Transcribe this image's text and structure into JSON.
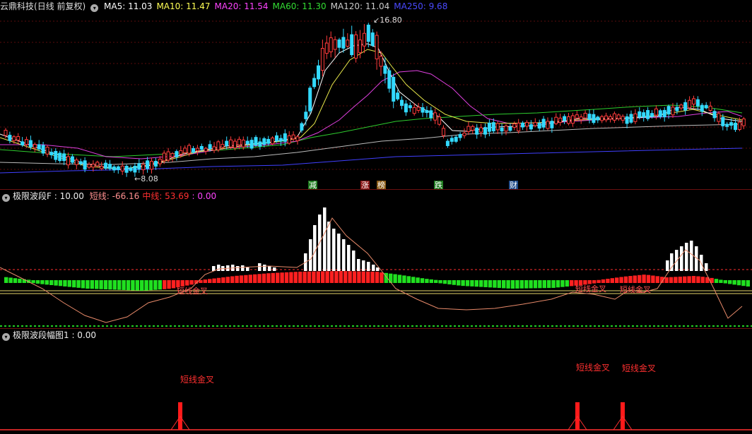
{
  "main_panel": {
    "stock_name": "云鼎科技",
    "period": "(日线 前复权)",
    "ma": [
      {
        "label": "MA5: 11.03",
        "color": "#ffffff"
      },
      {
        "label": "MA10: 11.47",
        "color": "#ffff55"
      },
      {
        "label": "MA20: 11.54",
        "color": "#ff44ff"
      },
      {
        "label": "MA60: 11.30",
        "color": "#33dd33"
      },
      {
        "label": "MA120: 11.04",
        "color": "#cccccc"
      },
      {
        "label": "MA250: 9.68",
        "color": "#4a4aff"
      }
    ],
    "high_label": "16.80",
    "low_label": "8.08",
    "events": [
      {
        "text": "减",
        "color": "#1e7a1e"
      },
      {
        "text": "涨",
        "color": "#8a1414"
      },
      {
        "text": "榜",
        "color": "#8a5a14"
      },
      {
        "text": "跌",
        "color": "#1e7a1e"
      },
      {
        "text": "财",
        "color": "#1e4a8a"
      }
    ]
  },
  "indicator_panel": {
    "title": "极限波段F : 10.00",
    "items": [
      {
        "label": "短线: -66.16",
        "color": "#ff9090"
      },
      {
        "label": "中线: 53.69",
        "color": "#ff3030"
      },
      {
        "label": ": 0.00",
        "color": "#ff44ff"
      }
    ],
    "signals": [
      "短线金叉",
      "短线金叉",
      "短线金叉"
    ]
  },
  "amplitude_panel": {
    "title": "极限波段幅图1 : 0.00",
    "signals": [
      "短线金叉",
      "短线金叉",
      "短线金叉"
    ]
  },
  "chart_data": {
    "type": "candlestick",
    "series": [
      "MA5",
      "MA10",
      "MA20",
      "MA60",
      "MA120",
      "MA250"
    ],
    "price_high": 16.8,
    "price_low": 8.08
  }
}
